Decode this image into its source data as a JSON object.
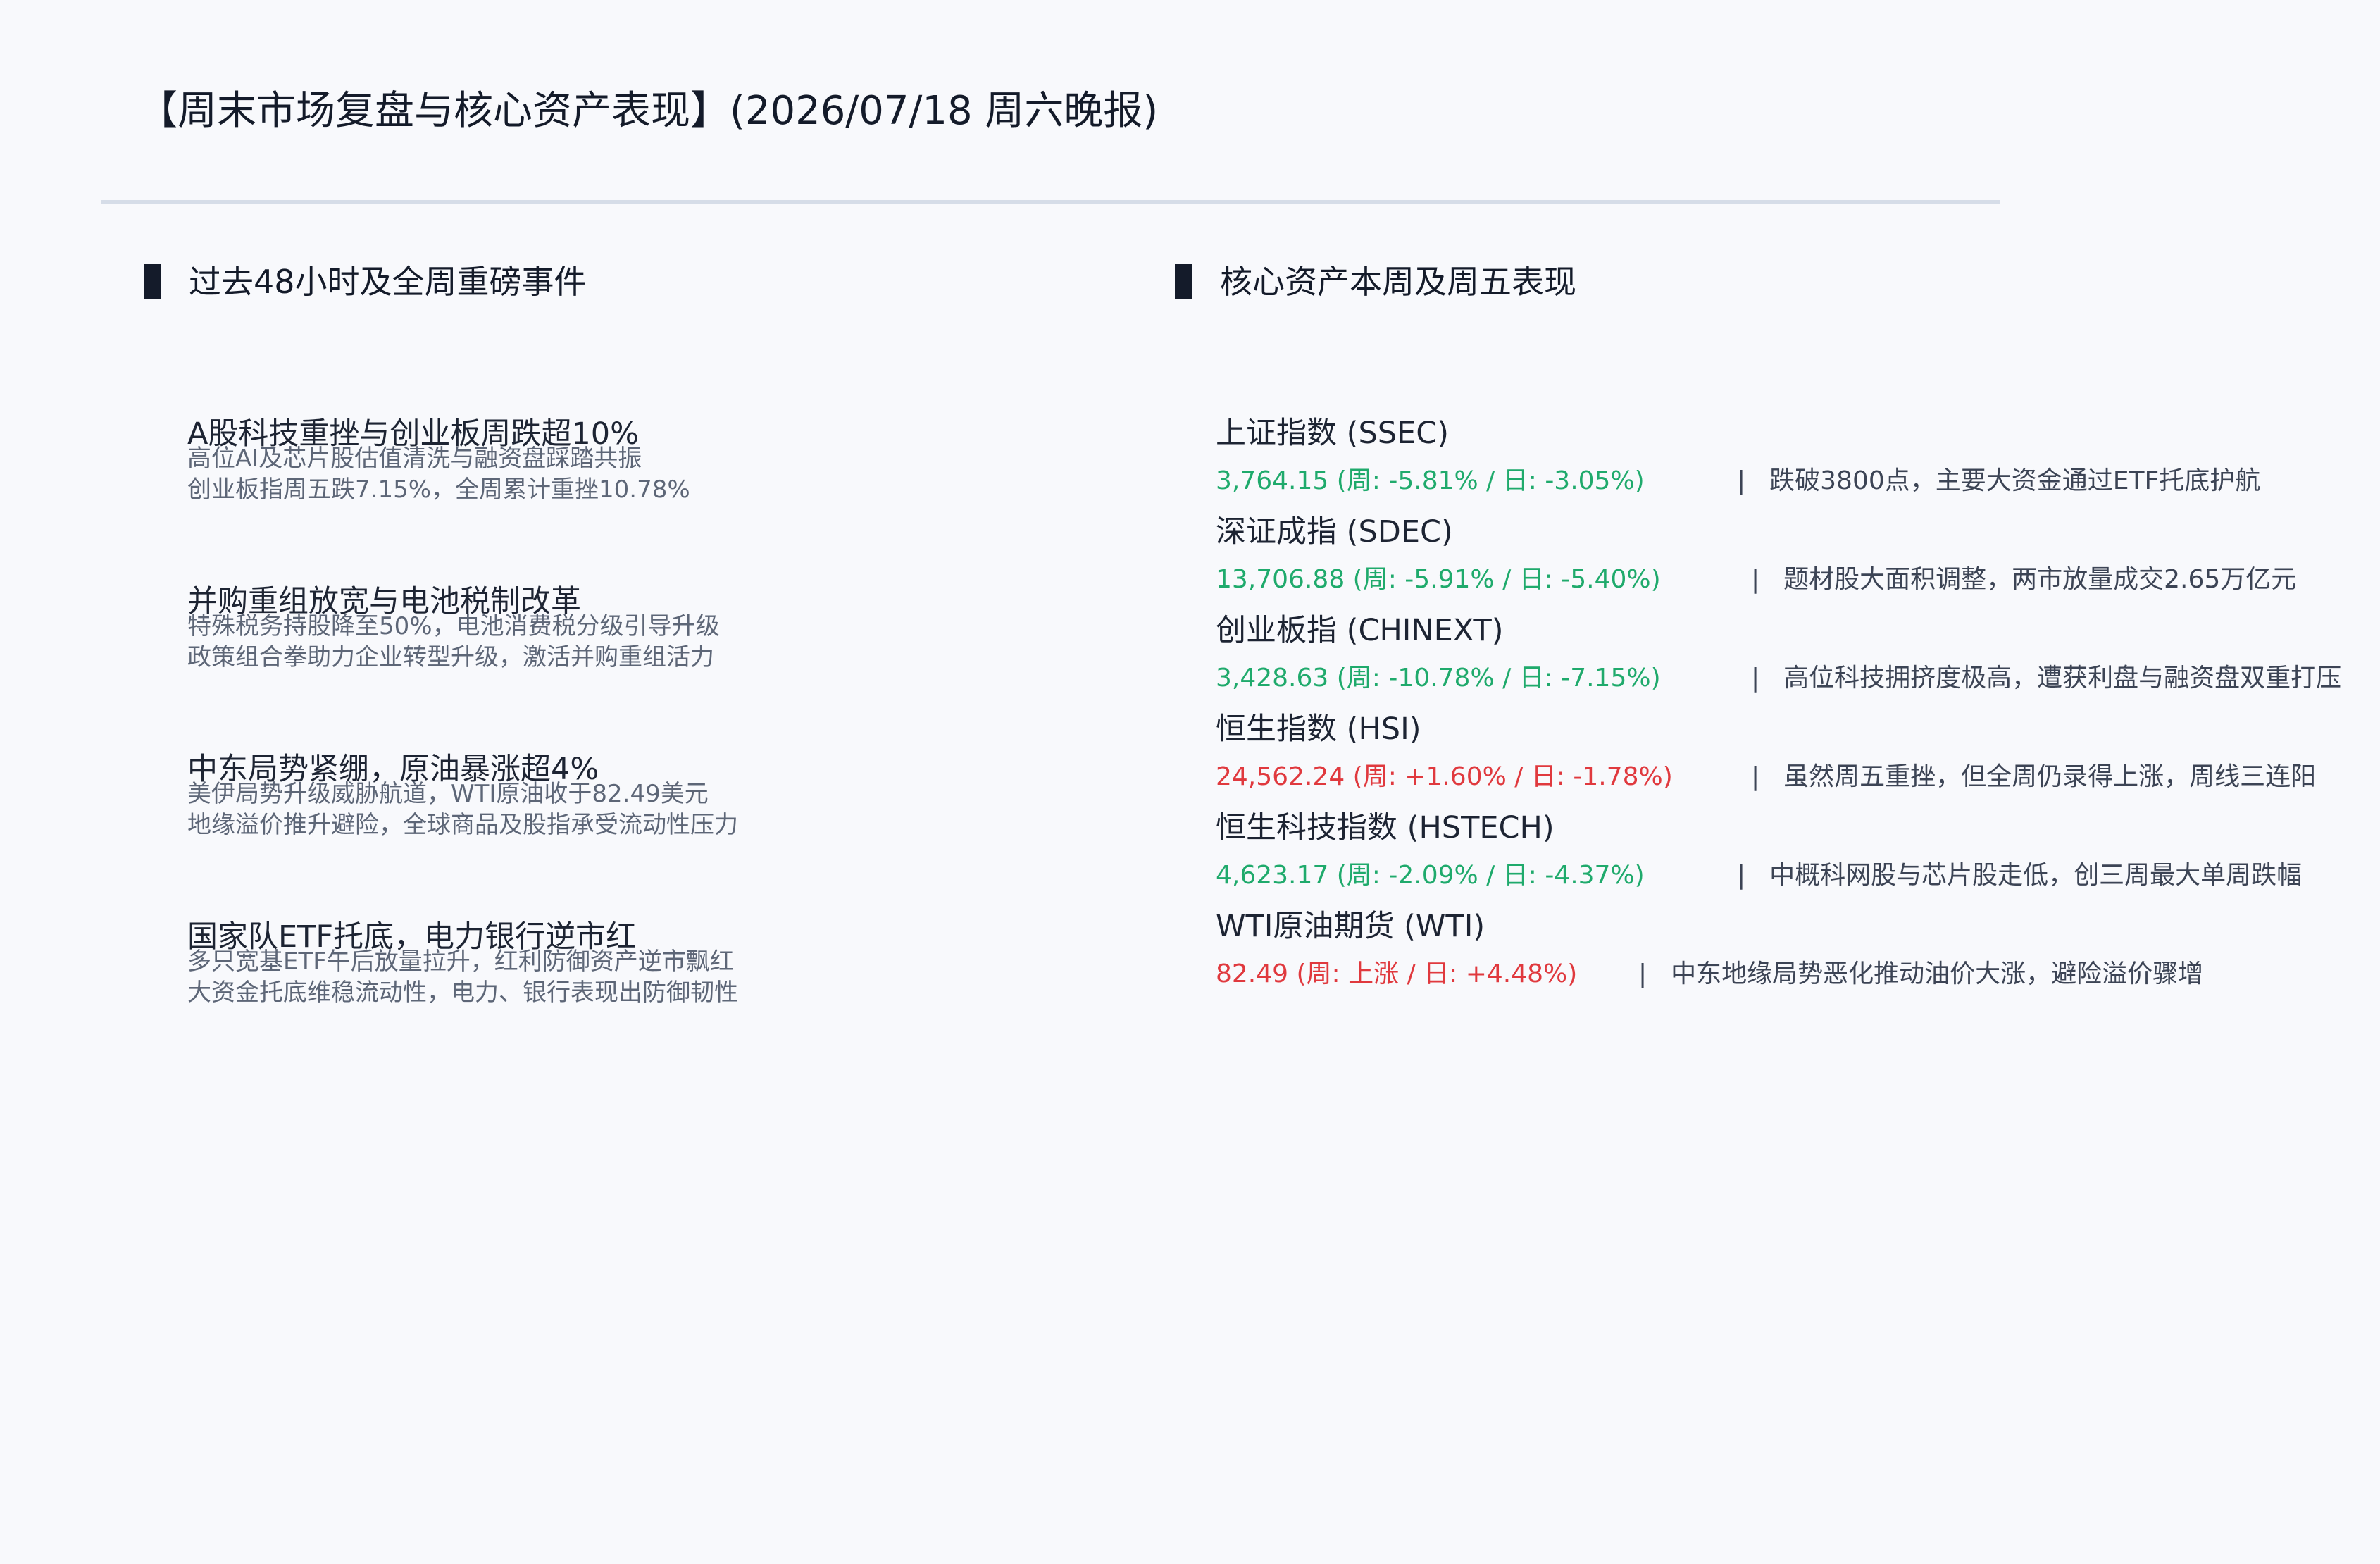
{
  "header": {
    "title": "【周末市场复盘与核心资产表现】(2026/07/18 周六晚报)"
  },
  "events_section": {
    "title": "过去48小时及全周重磅事件",
    "items": [
      {
        "title": "A股科技重挫与创业板周跌超10%",
        "line1": "高位AI及芯片股估值清洗与融资盘踩踏共振",
        "line2": "创业板指周五跌7.15%，全周累计重挫10.78%"
      },
      {
        "title": "并购重组放宽与电池税制改革",
        "line1": "特殊税务持股降至50%，电池消费税分级引导升级",
        "line2": "政策组合拳助力企业转型升级，激活并购重组活力"
      },
      {
        "title": "中东局势紧绷，原油暴涨超4%",
        "line1": "美伊局势升级威胁航道，WTI原油收于82.49美元",
        "line2": "地缘溢价推升避险，全球商品及股指承受流动性压力"
      },
      {
        "title": "国家队ETF托底，电力银行逆市红",
        "line1": "多只宽基ETF午后放量拉升，红利防御资产逆市飘红",
        "line2": "大资金托底维稳流动性，电力、银行表现出防御韧性"
      }
    ]
  },
  "assets_section": {
    "title": "核心资产本周及周五表现",
    "separator": "|",
    "items": [
      {
        "name": "上证指数 (SSEC)",
        "value": "3,764.15 (周: -5.81% / 日: -3.05%)",
        "direction": "down",
        "note": "跌破3800点，主要大资金通过ETF托底护航"
      },
      {
        "name": "深证成指 (SDEC)",
        "value": "13,706.88 (周: -5.91% / 日: -5.40%)",
        "direction": "down",
        "note": "题材股大面积调整，两市放量成交2.65万亿元"
      },
      {
        "name": "创业板指 (CHINEXT)",
        "value": "3,428.63 (周: -10.78% / 日: -7.15%)",
        "direction": "down",
        "note": "高位科技拥挤度极高，遭获利盘与融资盘双重打压"
      },
      {
        "name": "恒生指数 (HSI)",
        "value": "24,562.24 (周: +1.60% / 日: -1.78%)",
        "direction": "up",
        "note": "虽然周五重挫，但全周仍录得上涨，周线三连阳"
      },
      {
        "name": "恒生科技指数 (HSTECH)",
        "value": "4,623.17 (周: -2.09% / 日: -4.37%)",
        "direction": "down",
        "note": "中概科网股与芯片股走低，创三周最大单周跌幅"
      },
      {
        "name": "WTI原油期货 (WTI)",
        "value": "82.49 (周: 上涨 / 日: +4.48%)",
        "direction": "up",
        "note": "中东地缘局势恶化推动油价大涨，避险溢价骤增"
      }
    ]
  },
  "colors": {
    "down": "#1faa6c",
    "up": "#e0393e",
    "background": "#f8f9fc",
    "divider": "#d6dde8"
  }
}
